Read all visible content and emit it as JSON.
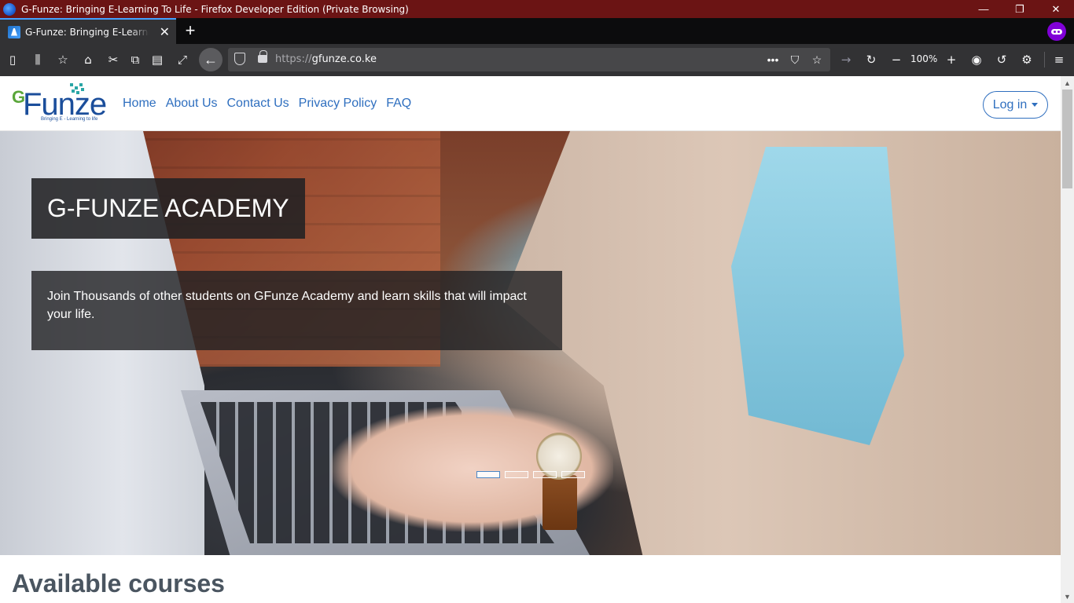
{
  "window": {
    "title": "G-Funze: Bringing E-Learning To Life - Firefox Developer Edition (Private Browsing)",
    "controls": {
      "minimize": "—",
      "restore": "❐",
      "close": "✕"
    }
  },
  "tabs": [
    {
      "title": "G-Funze: Bringing E-Learning To Life",
      "close": "✕"
    }
  ],
  "new_tab": "+",
  "toolbar": {
    "url_scheme": "https://",
    "url_host": "gfunze.co.ke",
    "zoom": "100%",
    "icons": [
      "sidebar-icon",
      "library-icon",
      "bookmark-star-icon",
      "home-icon",
      "cut-icon",
      "copy-icon",
      "paste-icon",
      "fullscreen-icon",
      "back-icon",
      "shield-icon",
      "lock-icon",
      "page-actions-icon",
      "pocket-icon",
      "bookmark-icon",
      "forward-icon",
      "reload-icon",
      "zoom-out-icon",
      "zoom-in-icon",
      "account-icon",
      "history-icon",
      "settings-icon",
      "menu-icon"
    ]
  },
  "site": {
    "logo": {
      "prefix": "G",
      "name": "Funze",
      "tagline": "Bringing E - Learning to life"
    },
    "nav": [
      "Home",
      "About Us",
      "Contact Us",
      "Privacy Policy",
      "FAQ"
    ],
    "login": "Log in",
    "hero": {
      "title": "G-FUNZE ACADEMY",
      "text": "Join Thousands of other students on GFunze Academy and learn skills that will impact your life.",
      "slides": 4,
      "active_slide": 1
    },
    "section_title": "Available courses"
  },
  "colors": {
    "titlebar": "#6b1414",
    "brand_blue": "#2f6fbf",
    "logo_green": "#5aa63a",
    "private_purple": "#8000d7"
  }
}
